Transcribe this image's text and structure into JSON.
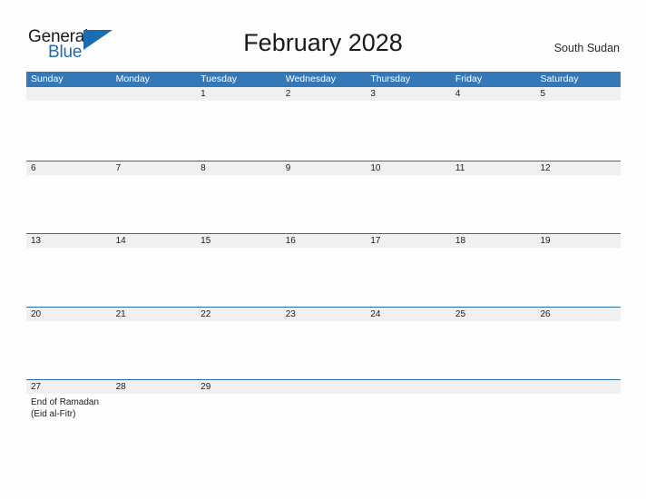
{
  "brand": {
    "word_one": "General",
    "word_two": "Blue",
    "flag_icon": "triangle-flag-icon",
    "accent_color": "#1b6cb0"
  },
  "header": {
    "title": "February 2028",
    "region": "South Sudan"
  },
  "calendar": {
    "header_bg": "#3578b8",
    "band_bg": "#f0f0f0",
    "row_divider": "#2b6ca8",
    "weekdays": [
      "Sunday",
      "Monday",
      "Tuesday",
      "Wednesday",
      "Thursday",
      "Friday",
      "Saturday"
    ],
    "weeks": [
      [
        {
          "day": ""
        },
        {
          "day": ""
        },
        {
          "day": "1",
          "events": []
        },
        {
          "day": "2",
          "events": []
        },
        {
          "day": "3",
          "events": []
        },
        {
          "day": "4",
          "events": []
        },
        {
          "day": "5",
          "events": []
        }
      ],
      [
        {
          "day": "6",
          "events": []
        },
        {
          "day": "7",
          "events": []
        },
        {
          "day": "8",
          "events": []
        },
        {
          "day": "9",
          "events": []
        },
        {
          "day": "10",
          "events": []
        },
        {
          "day": "11",
          "events": []
        },
        {
          "day": "12",
          "events": []
        }
      ],
      [
        {
          "day": "13",
          "events": []
        },
        {
          "day": "14",
          "events": []
        },
        {
          "day": "15",
          "events": []
        },
        {
          "day": "16",
          "events": []
        },
        {
          "day": "17",
          "events": []
        },
        {
          "day": "18",
          "events": []
        },
        {
          "day": "19",
          "events": []
        }
      ],
      [
        {
          "day": "20",
          "events": []
        },
        {
          "day": "21",
          "events": []
        },
        {
          "day": "22",
          "events": []
        },
        {
          "day": "23",
          "events": []
        },
        {
          "day": "24",
          "events": []
        },
        {
          "day": "25",
          "events": []
        },
        {
          "day": "26",
          "events": []
        }
      ],
      [
        {
          "day": "27",
          "events": [
            "End of Ramadan",
            "(Eid al-Fitr)"
          ]
        },
        {
          "day": "28",
          "events": []
        },
        {
          "day": "29",
          "events": []
        },
        {
          "day": ""
        },
        {
          "day": ""
        },
        {
          "day": ""
        },
        {
          "day": ""
        }
      ]
    ]
  }
}
